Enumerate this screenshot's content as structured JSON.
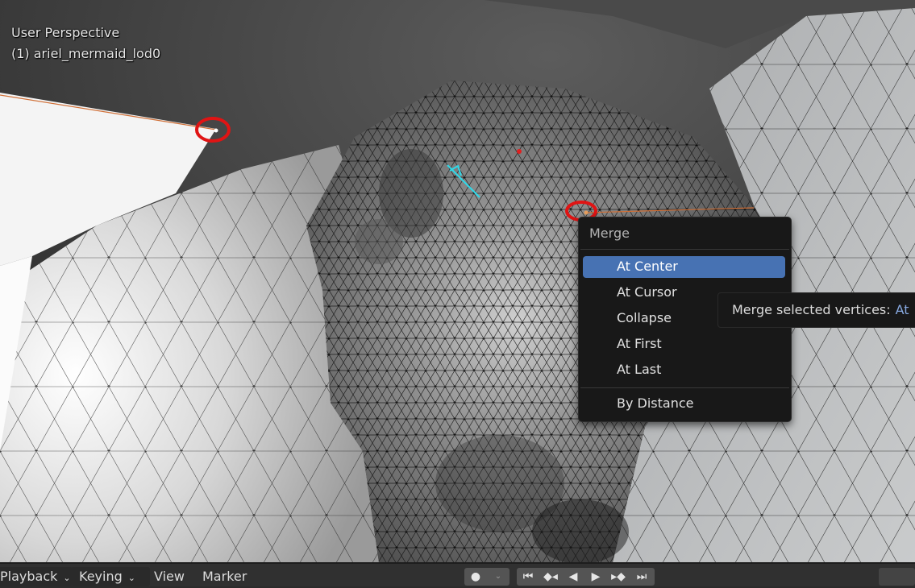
{
  "viewport": {
    "title": "User Perspective",
    "object": "(1) ariel_mermaid_lod0"
  },
  "merge_menu": {
    "title": "Merge",
    "items": [
      {
        "label": "At Center",
        "active": true
      },
      {
        "label": "At Cursor",
        "active": false
      },
      {
        "label": "Collapse",
        "active": false
      },
      {
        "label": "At First",
        "active": false
      },
      {
        "label": "At Last",
        "active": false
      },
      {
        "label": "By Distance",
        "active": false
      }
    ]
  },
  "tooltip": {
    "text": "Merge selected vertices:",
    "value": "At"
  },
  "timeline": {
    "playback": "Playback",
    "keying": "Keying",
    "view": "View",
    "marker": "Marker",
    "icons": [
      "record-icon",
      "jump-start-icon",
      "prev-keyframe-icon",
      "play-reverse-icon",
      "play-icon",
      "next-keyframe-icon",
      "jump-end-icon"
    ]
  },
  "colors": {
    "menu_bg": "#181818",
    "highlight": "#4772b3",
    "selection_circle": "#e01414",
    "edge_highlight": "#e07030",
    "tooltip_value": "#87a9e0"
  }
}
